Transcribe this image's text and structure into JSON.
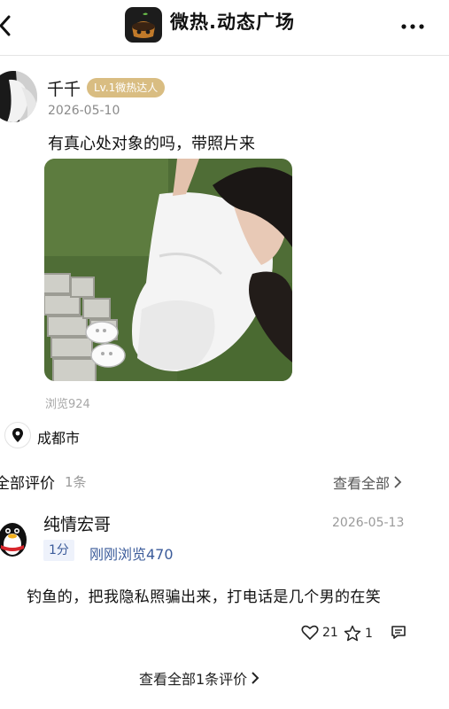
{
  "header": {
    "back_icon": "chevron-left-icon",
    "app_icon": "app-logo-icon",
    "title": "微热.动态广场",
    "more_icon": "more-horizontal-icon"
  },
  "post": {
    "author": "千千",
    "level_badge": "Lv.1微热达人",
    "date": "2026-05-10",
    "text": "有真心处对象的吗，带照片来",
    "image": "photo-of-woman-in-white-dress-on-grass",
    "views": "浏览924",
    "location_icon": "map-pin-icon",
    "location": "成都市"
  },
  "comments": {
    "title": "全部评价",
    "count": "1条",
    "see_all": "查看全部",
    "items": [
      {
        "author": "纯情宏哥",
        "avatar": "penguin-avatar-icon",
        "date": "2026-05-13",
        "score": "1分",
        "recent": "刚刚浏览470",
        "text": "钓鱼的，把我隐私照骗出来，打电话是几个男的在笑",
        "likes": "21",
        "stars": "1",
        "like_icon": "heart-icon",
        "star_icon": "star-icon",
        "reply_icon": "comment-icon"
      }
    ],
    "view_all": "查看全部1条评价"
  },
  "colors": {
    "badge": "#d9bd82",
    "link_blue": "#3b5b9a",
    "muted": "#9a9a9a"
  }
}
